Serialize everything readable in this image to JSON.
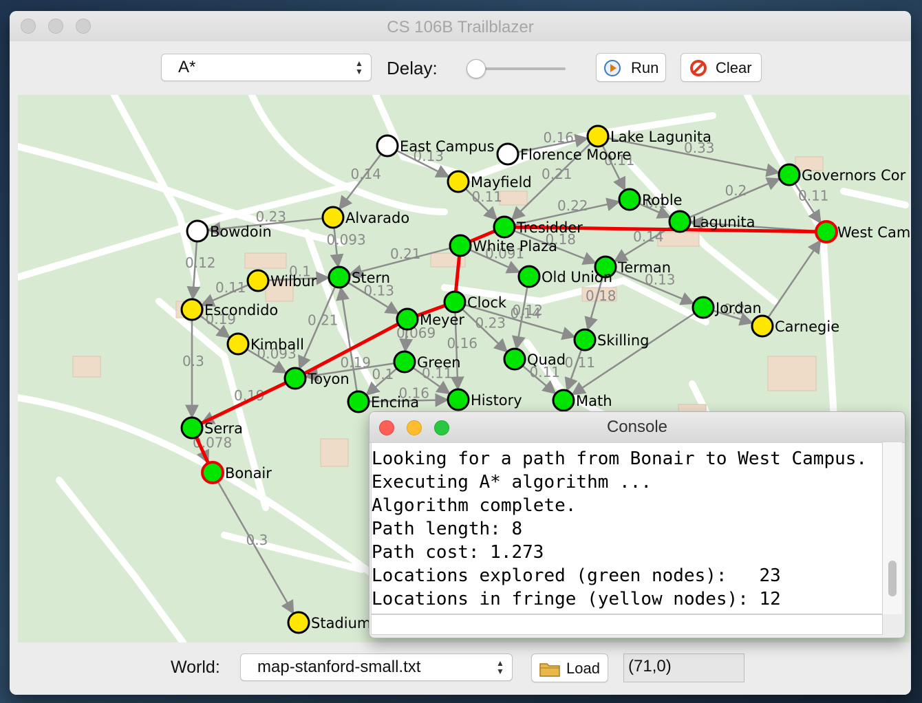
{
  "window": {
    "title": "CS 106B Trailblazer"
  },
  "toolbar": {
    "algorithm": "A*",
    "delay_label": "Delay:",
    "delay_value": 0,
    "run_label": "Run",
    "clear_label": "Clear"
  },
  "bottom": {
    "world_label": "World:",
    "world_file": "map-stanford-small.txt",
    "load_label": "Load",
    "coordinates": "(71,0)"
  },
  "console": {
    "title": "Console",
    "lines": [
      "Looking for a path from Bonair to West Campus.",
      "Executing A* algorithm ...",
      "Algorithm complete.",
      "Path length: 8",
      "Path cost: 1.273",
      "Locations explored (green nodes):   23",
      "Locations in fringe (yellow nodes): 12"
    ]
  },
  "colors": {
    "explored": "#00e600",
    "fringe": "#ffe600",
    "unvisited": "#ffffff",
    "path": "#ee0000",
    "map_bg": "#d9ead3",
    "road": "#ffffff",
    "edge": "#8c8c8c"
  },
  "icons": [
    "run-icon",
    "clear-icon",
    "folder-icon",
    "updown-icon"
  ],
  "map": {
    "nodes": [
      {
        "name": "East Campus",
        "state": "unvisited"
      },
      {
        "name": "Florence Moore",
        "state": "unvisited"
      },
      {
        "name": "Lake Lagunita",
        "state": "fringe"
      },
      {
        "name": "Mayfield",
        "state": "fringe"
      },
      {
        "name": "Governors Cor",
        "state": "explored"
      },
      {
        "name": "Roble",
        "state": "explored"
      },
      {
        "name": "Lagunita",
        "state": "explored"
      },
      {
        "name": "West Cam",
        "state": "path"
      },
      {
        "name": "Alvarado",
        "state": "fringe"
      },
      {
        "name": "Bowdoin",
        "state": "unvisited"
      },
      {
        "name": "Tresidder",
        "state": "explored"
      },
      {
        "name": "White Plaza",
        "state": "explored"
      },
      {
        "name": "Terman",
        "state": "explored"
      },
      {
        "name": "Wilbur",
        "state": "fringe"
      },
      {
        "name": "Stern",
        "state": "explored"
      },
      {
        "name": "Old Union",
        "state": "explored"
      },
      {
        "name": "Escondido",
        "state": "fringe"
      },
      {
        "name": "Clock",
        "state": "explored"
      },
      {
        "name": "Meyer",
        "state": "explored"
      },
      {
        "name": "Jordan",
        "state": "explored"
      },
      {
        "name": "Carnegie",
        "state": "fringe"
      },
      {
        "name": "Kimball",
        "state": "fringe"
      },
      {
        "name": "Skilling",
        "state": "explored"
      },
      {
        "name": "Green",
        "state": "explored"
      },
      {
        "name": "Quad",
        "state": "explored"
      },
      {
        "name": "Toyon",
        "state": "explored"
      },
      {
        "name": "Encina",
        "state": "explored"
      },
      {
        "name": "History",
        "state": "explored"
      },
      {
        "name": "Math",
        "state": "explored"
      },
      {
        "name": "Serra",
        "state": "explored"
      },
      {
        "name": "Bonair",
        "state": "path"
      },
      {
        "name": "Stadium",
        "state": "fringe"
      }
    ],
    "edge_weights": [
      "0.14",
      "0.13",
      "0.16",
      "0.11",
      "0.33",
      "0.21",
      "0.11",
      "0.2",
      "0.11",
      "0.22",
      "0.1",
      "0.23",
      "0.093",
      "0.12",
      "0.21",
      "0.091",
      "0.18",
      "0.14",
      "0.1",
      "0.11",
      "0.13",
      "0.13",
      "0.18",
      "0.12",
      "0.14",
      "0.23",
      "0.069",
      "0.16",
      "0.21",
      "0.19",
      "0.1",
      "0.11",
      "0.11",
      "0.11",
      "0.19",
      "0.093",
      "0.3",
      "0.19",
      "0.2",
      "0.078",
      "0.3",
      "0.16"
    ],
    "path": [
      "Bonair",
      "Serra",
      "Toyon",
      "Meyer",
      "Clock",
      "White Plaza",
      "Tresidder",
      "West Cam"
    ]
  }
}
